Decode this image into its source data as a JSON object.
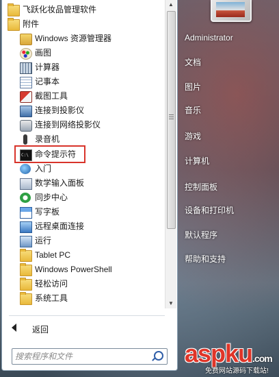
{
  "programs": {
    "folder_top": "飞跃化妆品管理软件",
    "folder_accessories": "附件",
    "items": [
      {
        "label": "Windows 资源管理器",
        "icon": "explorer-icon"
      },
      {
        "label": "画图",
        "icon": "paint-icon"
      },
      {
        "label": "计算器",
        "icon": "calculator-icon"
      },
      {
        "label": "记事本",
        "icon": "notepad-icon"
      },
      {
        "label": "截图工具",
        "icon": "snipping-tool-icon"
      },
      {
        "label": "连接到投影仪",
        "icon": "projector-icon"
      },
      {
        "label": "连接到网络投影仪",
        "icon": "network-projector-icon"
      },
      {
        "label": "录音机",
        "icon": "microphone-icon"
      },
      {
        "label": "命令提示符",
        "icon": "command-prompt-icon"
      },
      {
        "label": "入门",
        "icon": "getting-started-icon"
      },
      {
        "label": "数学输入面板",
        "icon": "math-input-icon"
      },
      {
        "label": "同步中心",
        "icon": "sync-center-icon"
      },
      {
        "label": "写字板",
        "icon": "wordpad-icon"
      },
      {
        "label": "远程桌面连接",
        "icon": "remote-desktop-icon"
      },
      {
        "label": "运行",
        "icon": "run-icon"
      }
    ],
    "subfolders": [
      "Tablet PC",
      "Windows PowerShell",
      "轻松访问",
      "系统工具"
    ]
  },
  "back_label": "返回",
  "search": {
    "placeholder": "搜索程序和文件"
  },
  "right_pane": {
    "items": [
      "Administrator",
      "文档",
      "图片",
      "音乐",
      "游戏",
      "计算机",
      "控制面板",
      "设备和打印机",
      "默认程序",
      "帮助和支持"
    ]
  },
  "watermark": {
    "logo": "aspku",
    "suffix": ".com",
    "tagline": "免费网站源码下载站!"
  },
  "colors": {
    "highlight": "#d8332a",
    "panel": "#ffffff"
  }
}
